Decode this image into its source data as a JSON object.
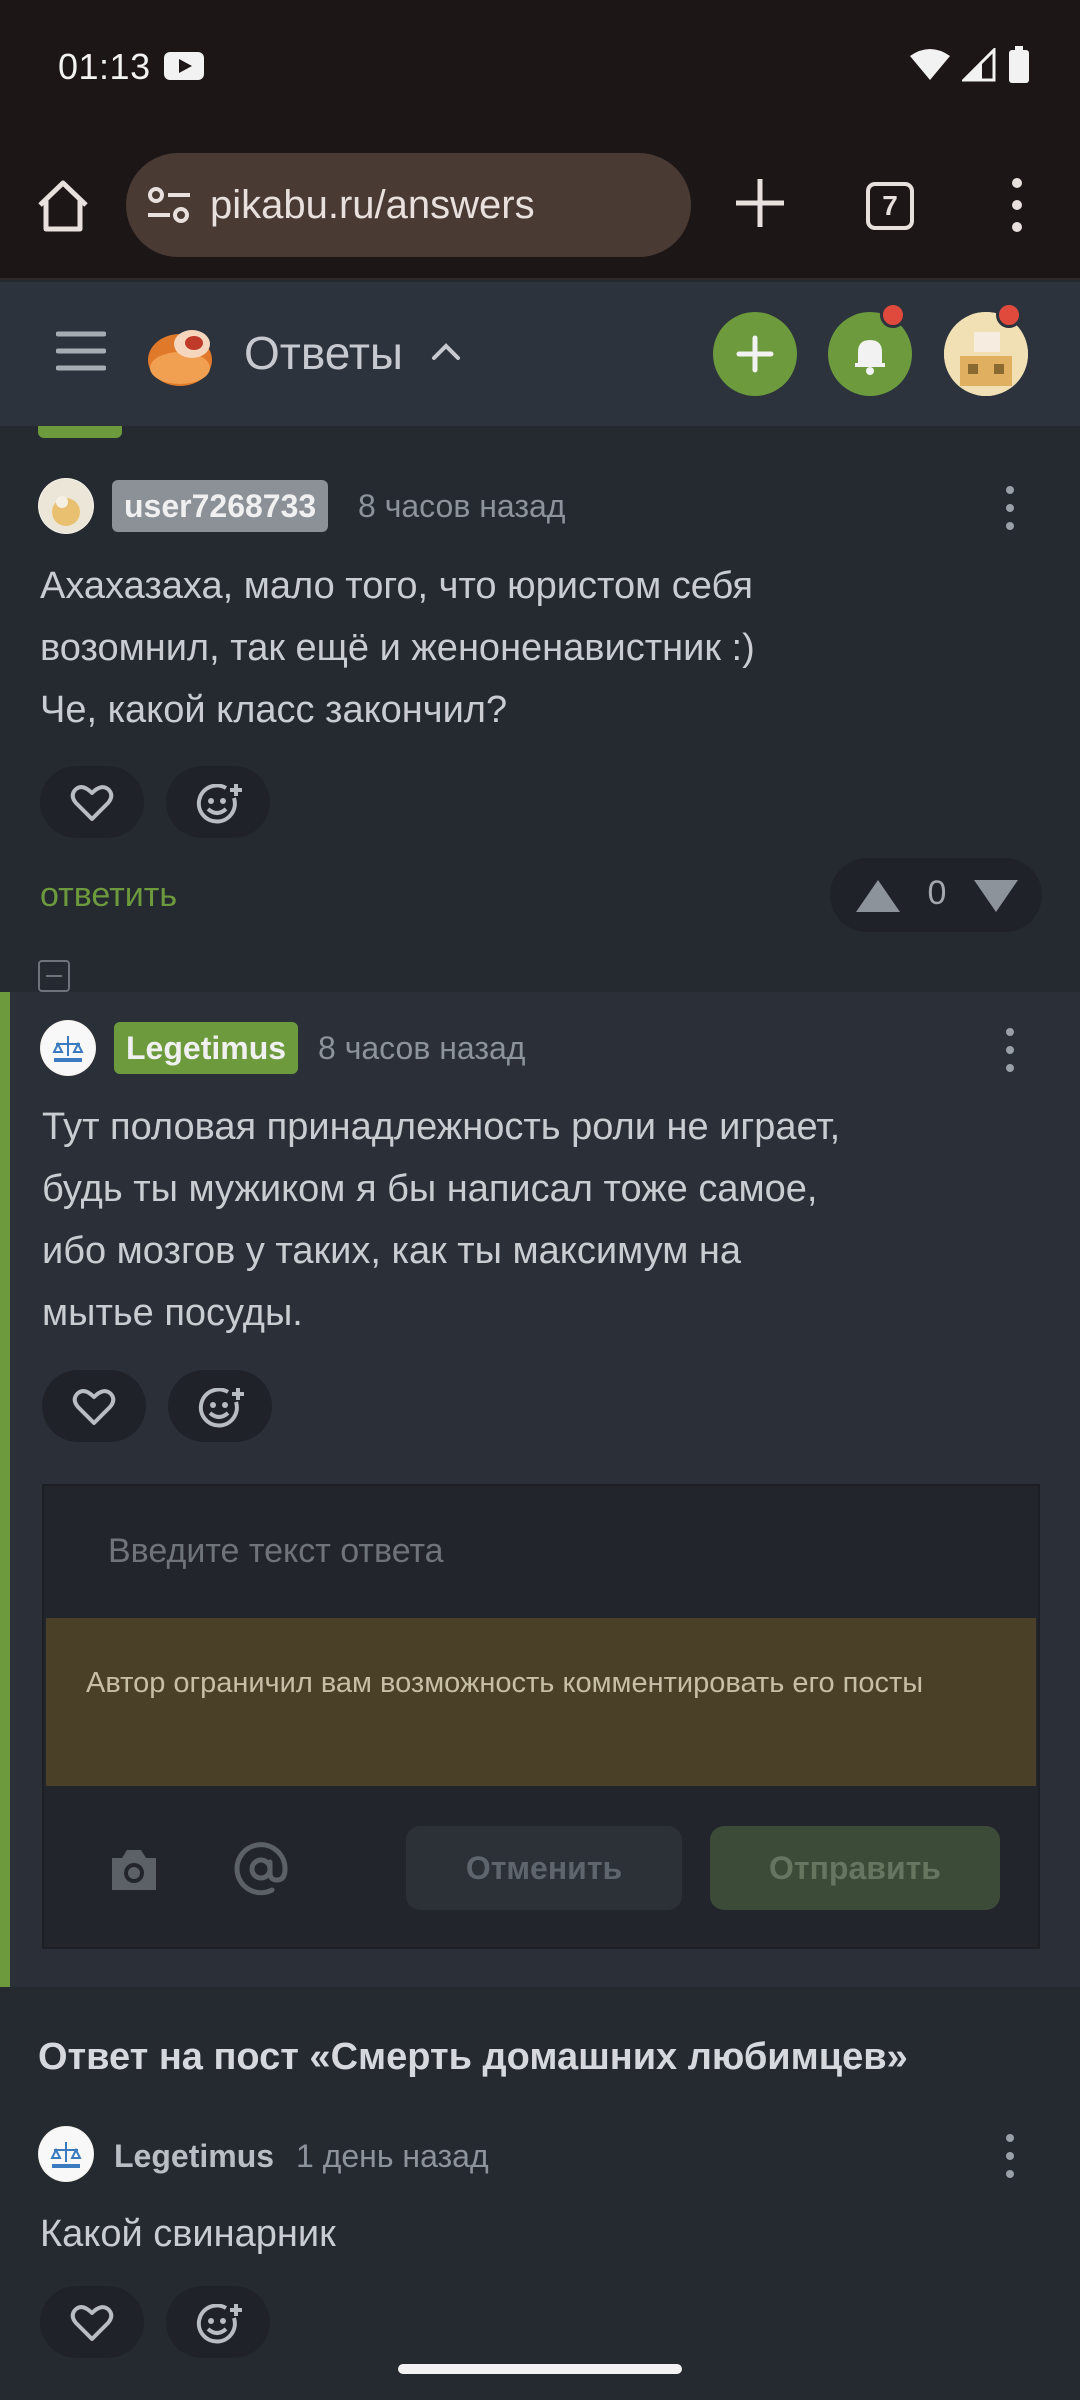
{
  "status_bar": {
    "time": "01:13"
  },
  "browser": {
    "url": "pikabu.ru/answers",
    "tab_count": "7"
  },
  "header": {
    "title": "Ответы"
  },
  "comments": [
    {
      "author": "user7268733",
      "time": "8 часов назад",
      "text": "Ахахазаха, мало того, что юристом себя\nвозомнил, так ещё и женоненавистник :)\nЧе, какой класс закончил?",
      "reply_label": "ответить",
      "rating": "0"
    },
    {
      "author": "Legetimus",
      "time": "8 часов назад",
      "text": "Тут половая принадлежность роли не играет,\nбудь ты мужиком я бы написал тоже самое,\nибо мозгов у таких, как ты максимум на\nмытье посуды."
    }
  ],
  "reply_form": {
    "placeholder": "Введите текст ответа",
    "restriction": "Автор ограничил вам возможность комментировать его посты",
    "cancel_label": "Отменить",
    "send_label": "Отправить"
  },
  "post": {
    "heading": "Ответ на пост «Смерть домашних любимцев»",
    "comment": {
      "author": "Legetimus",
      "time": "1 день назад",
      "text": "Какой свинарник"
    }
  },
  "colors": {
    "accent": "#6c9a3c",
    "background": "#252a31",
    "header": "#2c333c",
    "notice": "#4a4028"
  }
}
